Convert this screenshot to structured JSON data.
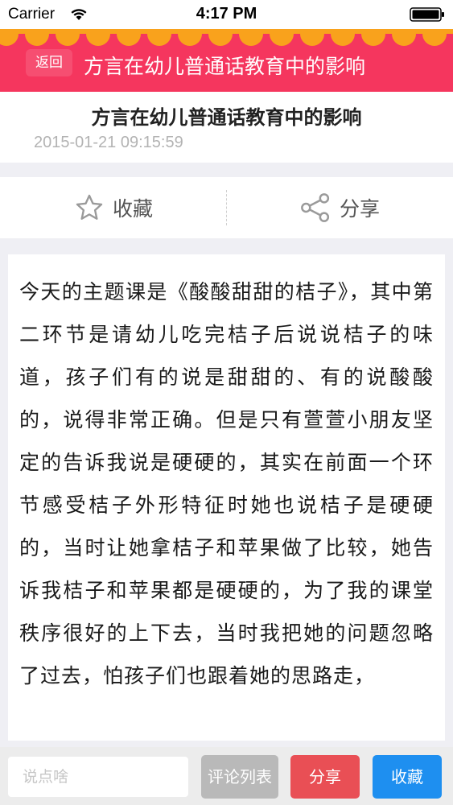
{
  "status_bar": {
    "carrier": "Carrier",
    "time": "4:17 PM"
  },
  "header": {
    "back_label": "返回",
    "title": "方言在幼儿普通话教育中的影响",
    "background": "#f5365e",
    "scallop_color": "#f9a21c"
  },
  "article": {
    "title": "方言在幼儿普通话教育中的影响",
    "date": "2015-01-21 09:15:59",
    "body": "今天的主题课是《酸酸甜甜的桔子》，其中第二环节是请幼儿吃完桔子后说说桔子的味道，孩子们有的说是甜甜的、有的说酸酸的，说得非常正确。但是只有萱萱小朋友坚定的告诉我说是硬硬的，其实在前面一个环节感受桔子外形特征时她也说桔子是硬硬的，当时让她拿桔子和苹果做了比较，她告诉我桔子和苹果都是硬硬的，为了我的课堂秩序很好的上下去，当时我把她的问题忽略了过去，怕孩子们也跟着她的思路走，"
  },
  "actions": {
    "favorite_label": "收藏",
    "favorite_icon": "star-icon",
    "share_label": "分享",
    "share_icon": "share-icon"
  },
  "bottom_bar": {
    "comment_placeholder": "说点啥",
    "comments_label": "评论列表",
    "share_label": "分享",
    "favorite_label": "收藏",
    "comments_color": "#b9b9b9",
    "share_color": "#e94f55",
    "favorite_color": "#1e8ff0"
  }
}
